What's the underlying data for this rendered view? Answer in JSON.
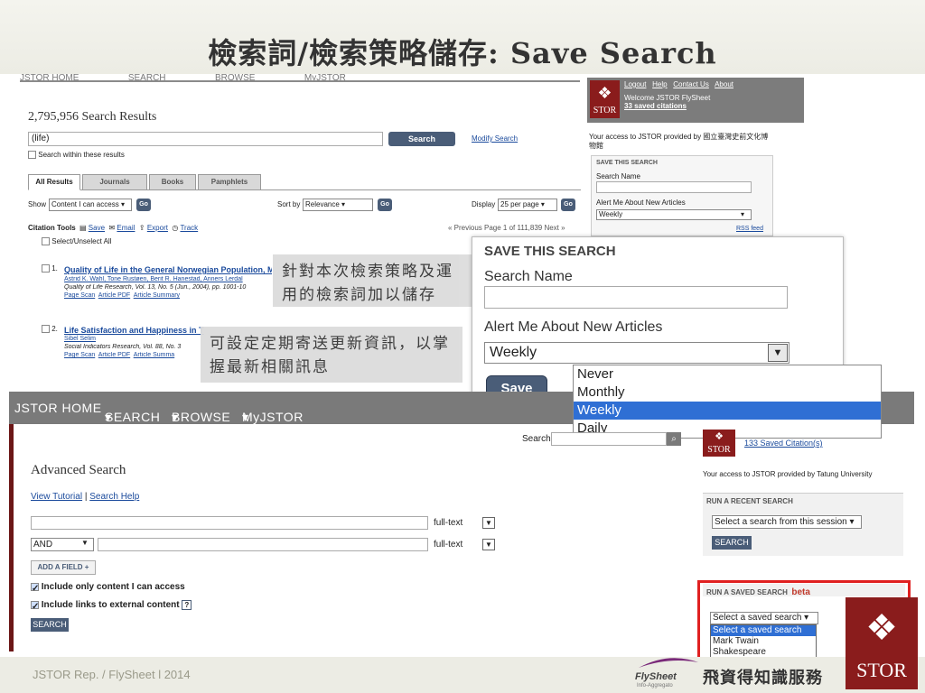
{
  "slide": {
    "title": "檢索詞/檢索策略儲存: Save Search",
    "footer_text": "JSTOR  Rep. / FlySheet   l   2014",
    "footer_brand_cn": "飛資得知識服務",
    "footer_brand_en": "FlySheet",
    "footer_brand_sub": "Info-Aggregato",
    "footer_logo": "STOR"
  },
  "top": {
    "nav_items": [
      "JSTOR HOME",
      "SEARCH",
      "BROWSE",
      "MyJSTOR"
    ],
    "results_count": "2,795,956 Search Results",
    "query_value": "(life)",
    "search_btn": "Search",
    "modify_search": "Modify Search",
    "search_within": "Search within these results",
    "tabs": [
      "All Results",
      "Journals",
      "Books",
      "Pamphlets"
    ],
    "show_label": "Show",
    "show_value": "Content I can access",
    "go": "Go",
    "sortby_label": "Sort by",
    "sortby_value": "Relevance",
    "display_label": "Display",
    "display_value": "25 per page",
    "citation_tools": "Citation Tools",
    "tool_save": "Save",
    "tool_email": "Email",
    "tool_export": "Export",
    "tool_track": "Track",
    "pager": "« Previous   Page 1 of 111,839   Next »",
    "select_unselect": "Select/Unselect All",
    "result1": {
      "num": "1.",
      "title": "Quality of Life in the General Norwegian Population, M",
      "authors": "Astrid K. Wahl, Tone Rustøen, Berit R. Hanestad, Anners Lerdal",
      "source": "Quality of Life Research, Vol. 13, No. 5 (Jun., 2004), pp. 1001-10",
      "links": [
        "Page Scan",
        "Article PDF",
        "Article Summary"
      ]
    },
    "result2": {
      "num": "2.",
      "title": "Life Satisfaction and Happiness in T",
      "authors": "Sibel Selim",
      "source": "Social Indicators Research, Vol. 88, No. 3",
      "links": [
        "Page Scan",
        "Article PDF",
        "Article Summa"
      ]
    },
    "side": {
      "links": [
        "Logout",
        "Help",
        "Contact Us",
        "About"
      ],
      "welcome": "Welcome JSTOR FlySheet",
      "saved": "33 saved citations",
      "logo": "STOR",
      "access": "Your access to JSTOR provided by 國立臺灣史前文化博物館",
      "box_title": "SAVE THIS SEARCH",
      "search_name": "Search Name",
      "alert_label": "Alert Me About New Articles",
      "alert_value": "Weekly",
      "rss": "RSS feed"
    }
  },
  "callouts": {
    "c1": "針對本次檢索策略及運用的檢索詞加以儲存",
    "c2": "可設定定期寄送更新資訊，以掌握最新相關訊息"
  },
  "popup": {
    "title": "SAVE THIS SEARCH",
    "search_name_label": "Search Name",
    "alert_label": "Alert Me About New Articles",
    "alert_value": "Weekly",
    "save_btn": "Save",
    "options": [
      "Never",
      "Monthly",
      "Weekly",
      "Daily"
    ],
    "selected": "Weekly"
  },
  "bottom": {
    "nav_items": [
      "JSTOR HOME",
      "SEARCH",
      "BROWSE",
      "MyJSTOR"
    ],
    "search_label": "Search",
    "heading": "Advanced Search",
    "view_tutorial": "View Tutorial",
    "search_help": "Search Help",
    "field_type1": "full-text",
    "field_type2": "full-text",
    "bool_value": "AND",
    "add_field": "ADD A FIELD +",
    "include_content": "Include only content I can access",
    "include_links": "Include links to external content",
    "search_btn": "SEARCH",
    "side": {
      "saved_citations": "133 Saved Citation(s)",
      "logo": "STOR",
      "access": "Your access to JSTOR provided by Tatung University",
      "recent_title": "RUN A RECENT SEARCH",
      "recent_select": "Select a search from this session",
      "recent_btn": "SEARCH",
      "saved_title": "RUN A SAVED SEARCH",
      "beta": "beta",
      "saved_select": "Select a saved search",
      "saved_options": [
        "Select a saved search",
        "Mark Twain",
        "Shakespeare"
      ],
      "saved_selected": "Select a saved search"
    }
  },
  "colors": {
    "accent_dark": "#4a5d78",
    "jstor_red": "#8a1c1c",
    "highlight_box": "#e02020",
    "selected_option": "#2f6fd4"
  }
}
